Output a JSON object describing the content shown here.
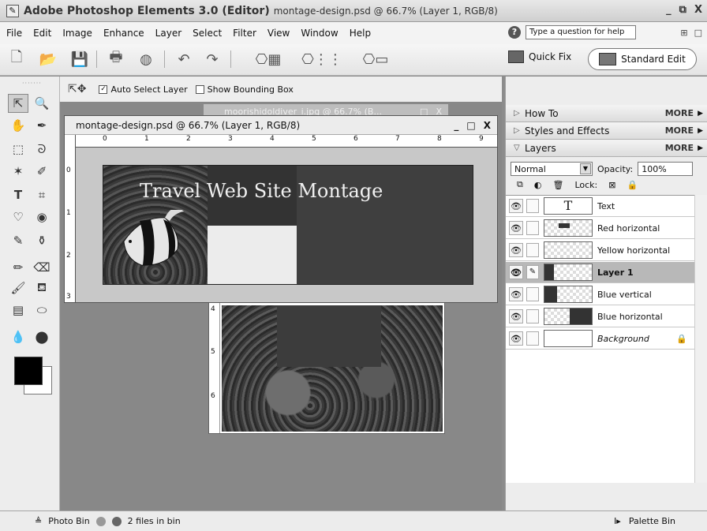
{
  "window": {
    "app_name": "Adobe Photoshop Elements 3.0 (Editor)",
    "doc_info": "montage-design.psd @ 66.7% (Layer 1, RGB/8)",
    "controls": [
      "_",
      "⧉",
      "X"
    ]
  },
  "menu": [
    "File",
    "Edit",
    "Image",
    "Enhance",
    "Layer",
    "Select",
    "Filter",
    "View",
    "Window",
    "Help"
  ],
  "help": {
    "placeholder": "Type a question for help"
  },
  "modes": {
    "quick_fix": "Quick Fix",
    "standard_edit": "Standard Edit"
  },
  "options": {
    "auto_select": "Auto Select Layer",
    "auto_select_checked": true,
    "show_bbox": "Show Bounding Box",
    "show_bbox_checked": false
  },
  "inactive_doc": {
    "title": "moorishidoldiver_i.jpg @ 66.7% (B...",
    "controls": [
      "_",
      "□",
      "X"
    ]
  },
  "doc": {
    "title": "montage-design.psd @ 66.7% (Layer 1, RGB/8)",
    "controls": [
      "_",
      "□",
      "X"
    ],
    "canvas_text": "Travel Web Site Montage",
    "ruler_h": [
      "0",
      "1",
      "2",
      "3",
      "4",
      "5",
      "6",
      "7",
      "8",
      "9"
    ],
    "ruler_v": [
      "0",
      "1",
      "2",
      "3"
    ]
  },
  "doc2": {
    "ruler_v": [
      "4",
      "5",
      "6"
    ]
  },
  "palette": {
    "how_to": "How To",
    "styles": "Styles and Effects",
    "layers": "Layers",
    "more": "MORE",
    "blend_mode": "Normal",
    "opacity_label": "Opacity:",
    "opacity_value": "100%",
    "lock_label": "Lock:",
    "layer_items": [
      {
        "name": "Text",
        "selected": false
      },
      {
        "name": "Red horizontal",
        "selected": false
      },
      {
        "name": "Yellow horizontal",
        "selected": false
      },
      {
        "name": "Layer 1",
        "selected": true
      },
      {
        "name": "Blue vertical",
        "selected": false
      },
      {
        "name": "Blue horizontal",
        "selected": false
      },
      {
        "name": "Background",
        "selected": false
      }
    ]
  },
  "status": {
    "photo_bin": "Photo Bin",
    "files": "2 files in bin",
    "palette_bin": "Palette Bin"
  }
}
